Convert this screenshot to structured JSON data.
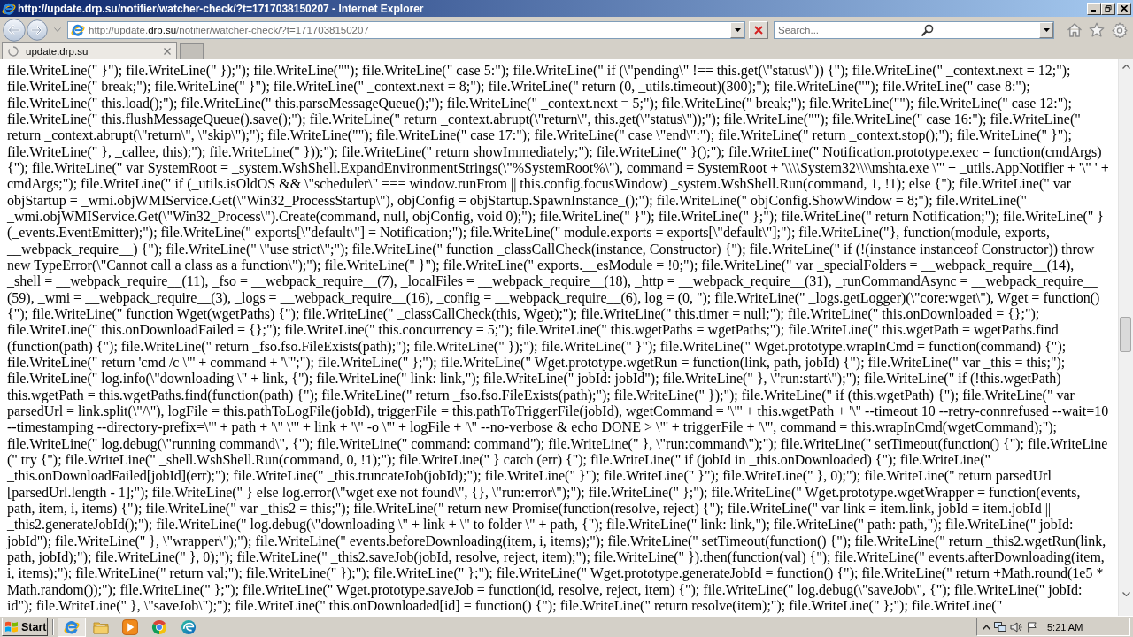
{
  "window": {
    "title": "http://update.drp.su/notifier/watcher-check/?t=1717038150207 - Internet Explorer"
  },
  "address_bar": {
    "url_parts": [
      {
        "text": "http://update.",
        "emphasized": false
      },
      {
        "text": "drp.su",
        "emphasized": true
      },
      {
        "text": "/notifier/watcher-check/?t=1717038150207",
        "emphasized": false
      }
    ]
  },
  "search": {
    "placeholder": "Search..."
  },
  "tabs": [
    {
      "label": "update.drp.su",
      "selected": true,
      "loading": true
    }
  ],
  "page": {
    "text_lines": [
      "file.WriteLine(\" }\"); file.WriteLine(\" });\"); file.WriteLine(\"\"); file.WriteLine(\" case 5:\"); file.WriteLine(\" if (\\\"pending\\\" !== this.get(\\\"status\\\")) {\"); file.WriteLine(\" _context.next = 12;\");",
      "file.WriteLine(\" break;\"); file.WriteLine(\" }\"); file.WriteLine(\" _context.next = 8;\"); file.WriteLine(\" return (0, _utils.timeout)(300);\"); file.WriteLine(\"\"); file.WriteLine(\" case 8:\");",
      "file.WriteLine(\" this.load();\"); file.WriteLine(\" this.parseMessageQueue();\"); file.WriteLine(\" _context.next = 5;\"); file.WriteLine(\" break;\"); file.WriteLine(\"\"); file.WriteLine(\" case 12:\");",
      "file.WriteLine(\" this.flushMessageQueue().save();\"); file.WriteLine(\" return _context.abrupt(\\\"return\\\", this.get(\\\"status\\\"));\"); file.WriteLine(\"\"); file.WriteLine(\" case 16:\"); file.WriteLine(\"",
      "return _context.abrupt(\\\"return\\\", \\\"skip\\\");\"); file.WriteLine(\"\"); file.WriteLine(\" case 17:\"); file.WriteLine(\" case \\\"end\\\":\"); file.WriteLine(\" return _context.stop();\"); file.WriteLine(\" }\");",
      "file.WriteLine(\" }, _callee, this);\"); file.WriteLine(\" }));\"); file.WriteLine(\" return showImmediately;\"); file.WriteLine(\" }();\"); file.WriteLine(\" Notification.prototype.exec = function(cmdArgs)",
      "{\"); file.WriteLine(\" var SystemRoot = _system.WshShell.ExpandEnvironmentStrings(\\\"%SystemRoot%\\\"), command = SystemRoot + '\\\\\\\\System32\\\\\\\\mshta.exe \\\"' + _utils.AppNotifier + '\\\" ' +",
      "cmdArgs;\"); file.WriteLine(\" if (_utils.isOldOS && \\\"scheduler\\\" === window.runFrom || this.config.focusWindow) _system.WshShell.Run(command, 1, !1); else {\"); file.WriteLine(\" var",
      "objStartup = _wmi.objWMIService.Get(\\\"Win32_ProcessStartup\\\"), objConfig = objStartup.SpawnInstance_();\"); file.WriteLine(\" objConfig.ShowWindow = 8;\"); file.WriteLine(\"",
      "_wmi.objWMIService.Get(\\\"Win32_Process\\\").Create(command, null, objConfig, void 0);\"); file.WriteLine(\" }\"); file.WriteLine(\" };\"); file.WriteLine(\" return Notification;\"); file.WriteLine(\" }",
      "(_events.EventEmitter);\"); file.WriteLine(\" exports[\\\"default\\\"] = Notification;\"); file.WriteLine(\" module.exports = exports[\\\"default\\\"];\"); file.WriteLine(\"}, function(module, exports,",
      "__webpack_require__) {\"); file.WriteLine(\" \\\"use strict\\\";\"); file.WriteLine(\" function _classCallCheck(instance, Constructor) {\"); file.WriteLine(\" if (!(instance instanceof Constructor)) throw",
      "new TypeError(\\\"Cannot call a class as a function\\\");\"); file.WriteLine(\" }\"); file.WriteLine(\" exports.__esModule = !0;\"); file.WriteLine(\" var _specialFolders = __webpack_require__(14),",
      "_shell = __webpack_require__(11), _fso = __webpack_require__(7), _localFiles = __webpack_require__(18), _http = __webpack_require__(31), _runCommandAsync = __webpack_require__",
      "(59), _wmi = __webpack_require__(3), _logs = __webpack_require__(16), _config = __webpack_require__(6), log = (0, \"); file.WriteLine(\" _logs.getLogger)(\\\"core:wget\\\"), Wget = function()",
      "{\"); file.WriteLine(\" function Wget(wgetPaths) {\"); file.WriteLine(\" _classCallCheck(this, Wget);\"); file.WriteLine(\" this.timer = null;\"); file.WriteLine(\" this.onDownloaded = {};\");",
      "file.WriteLine(\" this.onDownloadFailed = {};\"); file.WriteLine(\" this.concurrency = 5;\"); file.WriteLine(\" this.wgetPaths = wgetPaths;\"); file.WriteLine(\" this.wgetPath = wgetPaths.find",
      "(function(path) {\"); file.WriteLine(\" return _fso.fso.FileExists(path);\"); file.WriteLine(\" });\"); file.WriteLine(\" }\"); file.WriteLine(\" Wget.prototype.wrapInCmd = function(command) {\");",
      "file.WriteLine(\" return 'cmd /c \\\"' + command + '\\\"';\"); file.WriteLine(\" };\"); file.WriteLine(\" Wget.prototype.wgetRun = function(link, path, jobId) {\"); file.WriteLine(\" var _this = this;\");",
      "file.WriteLine(\" log.info(\\\"downloading \\\" + link, {\"); file.WriteLine(\" link: link,\"); file.WriteLine(\" jobId: jobId\"); file.WriteLine(\" }, \\\"run:start\\\");\"); file.WriteLine(\" if (!this.wgetPath)",
      "this.wgetPath = this.wgetPaths.find(function(path) {\"); file.WriteLine(\" return _fso.fso.FileExists(path);\"); file.WriteLine(\" });\"); file.WriteLine(\" if (this.wgetPath) {\"); file.WriteLine(\" var",
      "parsedUrl = link.split(\\\"/\\\"), logFile = this.pathToLogFile(jobId), triggerFile = this.pathToTriggerFile(jobId), wgetCommand = '\\\"' + this.wgetPath + '\\\" --timeout 10 --retry-connrefused --wait=10",
      "--timestamping --directory-prefix=\\\"' + path + '\\\" \\\"' + link + '\\\" -o \\\"' + logFile + '\\\" --no-verbose & echo DONE > \\\"' + triggerFile + '\\\"', command = this.wrapInCmd(wgetCommand);\");",
      "file.WriteLine(\" log.debug(\\\"running command\\\", {\"); file.WriteLine(\" command: command\"); file.WriteLine(\" }, \\\"run:command\\\");\"); file.WriteLine(\" setTimeout(function() {\"); file.WriteLine",
      "(\" try {\"); file.WriteLine(\" _shell.WshShell.Run(command, 0, !1);\"); file.WriteLine(\" } catch (err) {\"); file.WriteLine(\" if (jobId in _this.onDownloaded) {\"); file.WriteLine(\"",
      "_this.onDownloadFailed[jobId](err);\"); file.WriteLine(\" _this.truncateJob(jobId);\"); file.WriteLine(\" }\"); file.WriteLine(\" }\"); file.WriteLine(\" }, 0);\"); file.WriteLine(\" return parsedUrl",
      "[parsedUrl.length - 1];\"); file.WriteLine(\" } else log.error(\\\"wget exe not found\\\", {}, \\\"run:error\\\");\"); file.WriteLine(\" };\"); file.WriteLine(\" Wget.prototype.wgetWrapper = function(events,",
      "path, item, i, items) {\"); file.WriteLine(\" var _this2 = this;\"); file.WriteLine(\" return new Promise(function(resolve, reject) {\"); file.WriteLine(\" var link = item.link, jobId = item.jobId ||",
      "_this2.generateJobId();\"); file.WriteLine(\" log.debug(\\\"downloading \\\" + link + \\\" to folder \\\" + path, {\"); file.WriteLine(\" link: link,\"); file.WriteLine(\" path: path,\"); file.WriteLine(\" jobId:",
      "jobId\"); file.WriteLine(\" }, \\\"wrapper\\\");\"); file.WriteLine(\" events.beforeDownloading(item, i, items);\"); file.WriteLine(\" setTimeout(function() {\"); file.WriteLine(\" return _this2.wgetRun(link,",
      "path, jobId);\"); file.WriteLine(\" }, 0);\"); file.WriteLine(\" _this2.saveJob(jobId, resolve, reject, item);\"); file.WriteLine(\" }).then(function(val) {\"); file.WriteLine(\" events.afterDownloading(item,",
      "i, items);\"); file.WriteLine(\" return val;\"); file.WriteLine(\" });\"); file.WriteLine(\" };\"); file.WriteLine(\" Wget.prototype.generateJobId = function() {\"); file.WriteLine(\" return +Math.round(1e5 *",
      "Math.random());\"); file.WriteLine(\" };\"); file.WriteLine(\" Wget.prototype.saveJob = function(id, resolve, reject, item) {\"); file.WriteLine(\" log.debug(\\\"saveJob\\\", {\"); file.WriteLine(\" jobId:",
      "id\"); file.WriteLine(\" }, \\\"saveJob\\\");\"); file.WriteLine(\" this.onDownloaded[id] = function() {\"); file.WriteLine(\" return resolve(item);\"); file.WriteLine(\" };\"); file.WriteLine(\""
    ]
  },
  "taskbar": {
    "start_label": "Start",
    "clock": "5:21 AM",
    "pinned_apps": [
      {
        "kind": "internet_explorer",
        "active": true
      },
      {
        "kind": "file_explorer",
        "active": false
      },
      {
        "kind": "media_player",
        "active": false
      },
      {
        "kind": "chrome",
        "active": false
      },
      {
        "kind": "edge",
        "active": false
      }
    ]
  }
}
